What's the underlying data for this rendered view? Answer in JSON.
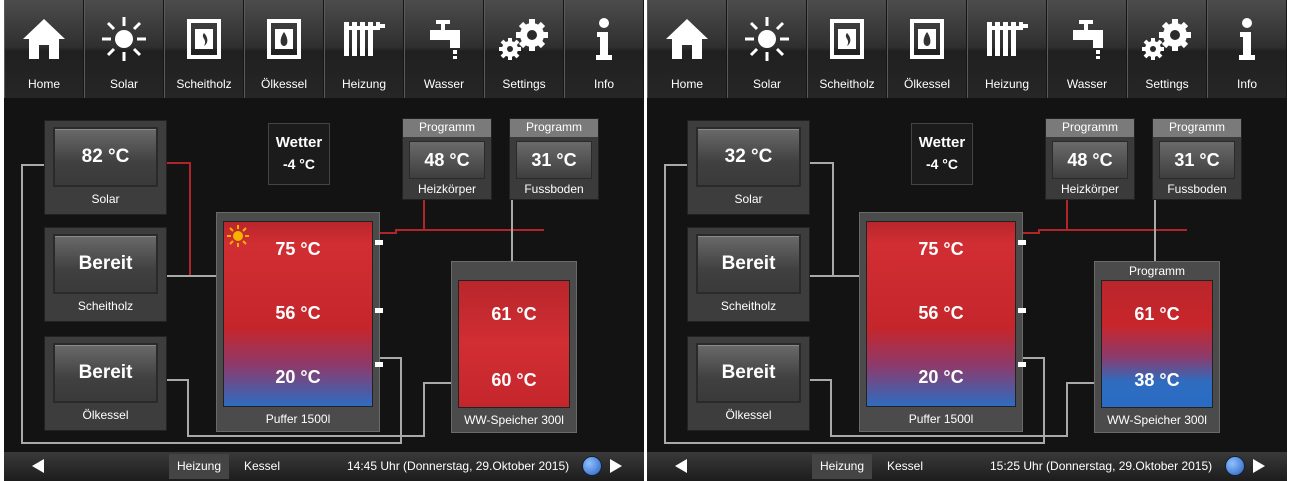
{
  "nav": [
    "Home",
    "Solar",
    "Scheitholz",
    "Ölkessel",
    "Heizung",
    "Wasser",
    "Settings",
    "Info"
  ],
  "icons": [
    "home-icon",
    "sun-icon",
    "wood-stove-icon",
    "oil-boiler-icon",
    "radiator-icon",
    "faucet-icon",
    "gears-icon",
    "info-icon"
  ],
  "colors": {
    "red_line": "#b0242a",
    "pipe": "#a9a9a9",
    "tank_red": "#c8262b",
    "tank_blue": "#2a6cc4"
  },
  "screens": [
    {
      "solar": {
        "value": "82 °C",
        "label": "Solar"
      },
      "scheitholz": {
        "value": "Bereit",
        "label": "Scheitholz"
      },
      "oelkessel": {
        "value": "Bereit",
        "label": "Ölkessel"
      },
      "wetter": {
        "title": "Wetter",
        "value": "-4 °C"
      },
      "heizkoerper": {
        "header": "Programm",
        "value": "48 °C",
        "label": "Heizkörper"
      },
      "fussboden": {
        "header": "Programm",
        "value": "31 °C",
        "label": "Fussboden"
      },
      "puffer": {
        "top": "75 °C",
        "mid": "56 °C",
        "bottom": "20 °C",
        "label": "Puffer 1500l",
        "sun_active": true
      },
      "ww": {
        "header": "",
        "top": "61 °C",
        "bottom": "60 °C",
        "label": "WW-Speicher 300l"
      },
      "bottom": {
        "tab1": "Heizung",
        "tab2": "Kessel",
        "status": "14:45 Uhr (Donnerstag, 29.Oktober 2015)"
      }
    },
    {
      "solar": {
        "value": "32 °C",
        "label": "Solar"
      },
      "scheitholz": {
        "value": "Bereit",
        "label": "Scheitholz"
      },
      "oelkessel": {
        "value": "Bereit",
        "label": "Ölkessel"
      },
      "wetter": {
        "title": "Wetter",
        "value": "-4 °C"
      },
      "heizkoerper": {
        "header": "Programm",
        "value": "48 °C",
        "label": "Heizkörper"
      },
      "fussboden": {
        "header": "Programm",
        "value": "31 °C",
        "label": "Fussboden"
      },
      "puffer": {
        "top": "75 °C",
        "mid": "56 °C",
        "bottom": "20 °C",
        "label": "Puffer 1500l",
        "sun_active": false
      },
      "ww": {
        "header": "Programm",
        "top": "61 °C",
        "bottom": "38 °C",
        "label": "WW-Speicher 300l"
      },
      "bottom": {
        "tab1": "Heizung",
        "tab2": "Kessel",
        "status": "15:25 Uhr (Donnerstag, 29.Oktober 2015)"
      }
    }
  ]
}
